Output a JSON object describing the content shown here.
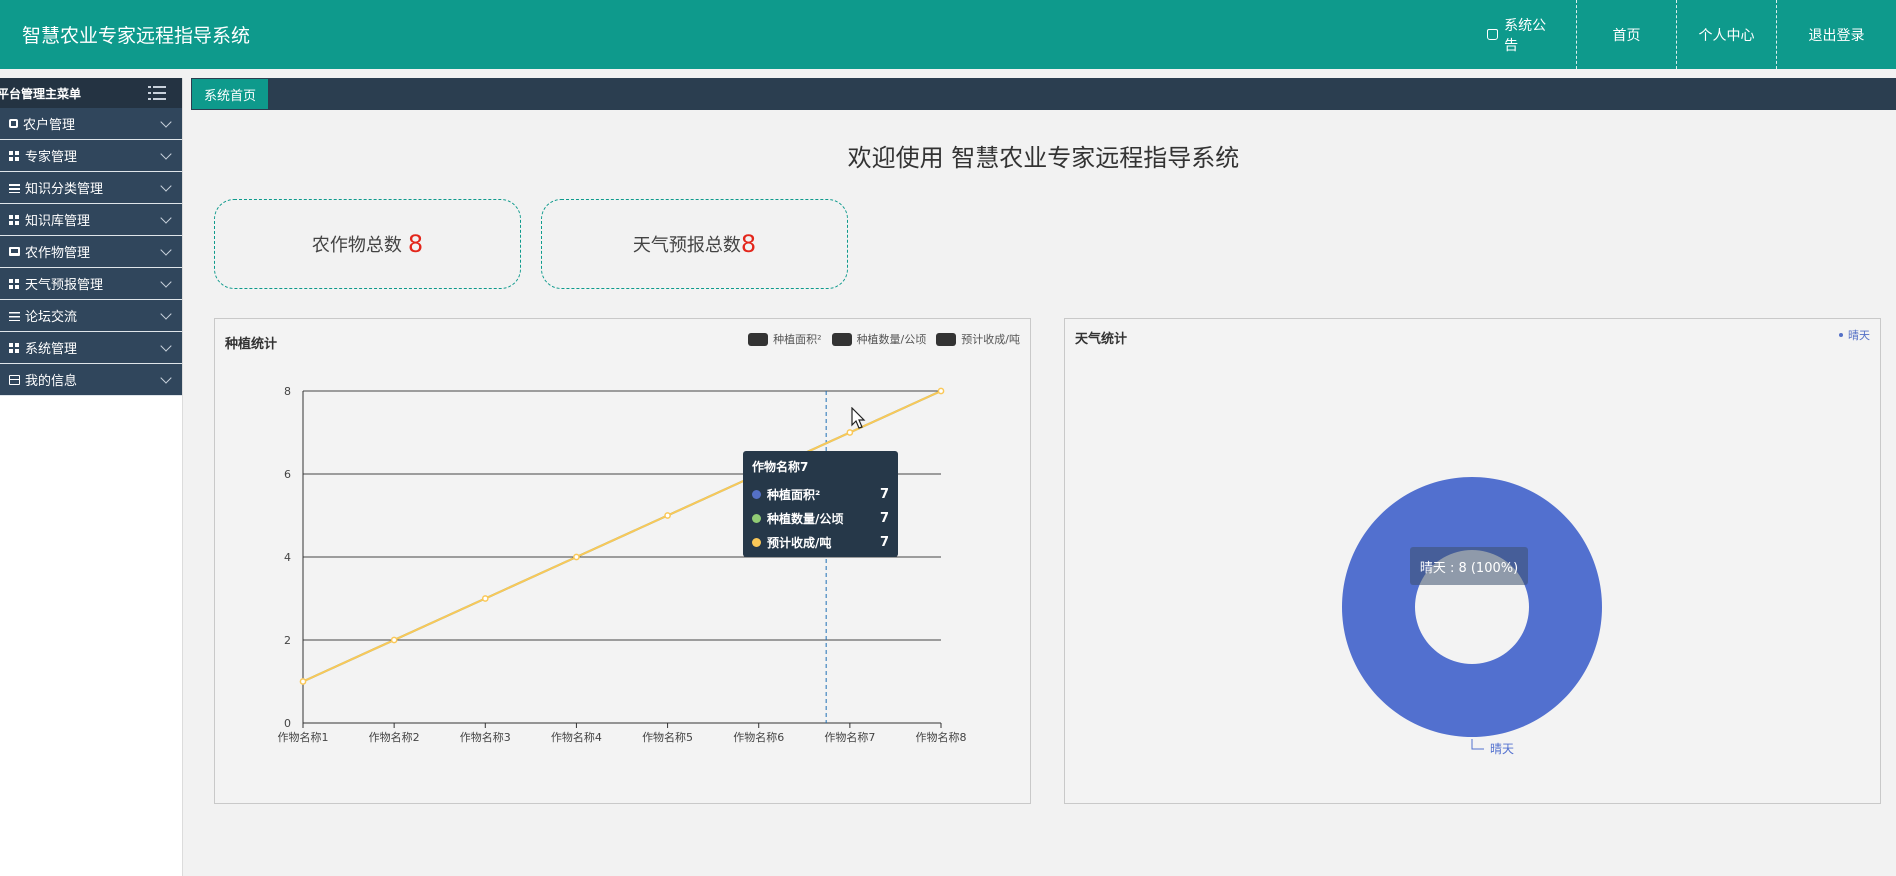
{
  "app": {
    "title": "智慧农业专家远程指导系统"
  },
  "topnav": {
    "notice": "系统公告",
    "home": "首页",
    "center": "个人中心",
    "logout": "退出登录"
  },
  "sidebar": {
    "title": "平台管理主菜单",
    "items": [
      {
        "label": "农户管理",
        "icon": "doc-icon"
      },
      {
        "label": "专家管理",
        "icon": "grid-icon"
      },
      {
        "label": "知识分类管理",
        "icon": "list-icon"
      },
      {
        "label": "知识库管理",
        "icon": "grid-icon"
      },
      {
        "label": "农作物管理",
        "icon": "monitor-icon"
      },
      {
        "label": "天气预报管理",
        "icon": "grid-icon"
      },
      {
        "label": "论坛交流",
        "icon": "slider-icon"
      },
      {
        "label": "系统管理",
        "icon": "grid-icon"
      },
      {
        "label": "我的信息",
        "icon": "card-icon"
      }
    ]
  },
  "tabs": {
    "home": "系统首页"
  },
  "welcome": "欢迎使用 智慧农业专家远程指导系统",
  "stats": {
    "crops_label": "农作物总数",
    "crops_value": "8",
    "weather_label": "天气预报总数",
    "weather_value": "8"
  },
  "colors": {
    "brand": "#0e9a8c",
    "nav_dark": "#2b3e50",
    "highlight_number": "#e3261b",
    "series_blue": "#5470c6",
    "series_green": "#91cc75",
    "series_yellow": "#fac858"
  },
  "planting_chart": {
    "title": "种植统计",
    "legend": [
      "种植面积²",
      "种植数量/公顷",
      "预计收成/吨"
    ],
    "tooltip": {
      "title": "作物名称7",
      "rows": [
        {
          "name": "种植面积²",
          "value": "7"
        },
        {
          "name": "种植数量/公顷",
          "value": "7"
        },
        {
          "name": "预计收成/吨",
          "value": "7"
        }
      ]
    }
  },
  "weather_chart": {
    "title": "天气统计",
    "legend": "晴天",
    "tooltip": "晴天 : 8 (100%)",
    "slice_label": "晴天"
  },
  "chart_data": [
    {
      "type": "line",
      "title": "种植统计",
      "categories": [
        "作物名称1",
        "作物名称2",
        "作物名称3",
        "作物名称4",
        "作物名称5",
        "作物名称6",
        "作物名称7",
        "作物名称8"
      ],
      "series": [
        {
          "name": "种植面积²",
          "values": [
            1,
            2,
            3,
            4,
            5,
            6,
            7,
            8
          ]
        },
        {
          "name": "种植数量/公顷",
          "values": [
            1,
            2,
            3,
            4,
            5,
            6,
            7,
            8
          ]
        },
        {
          "name": "预计收成/吨",
          "values": [
            1,
            2,
            3,
            4,
            5,
            6,
            7,
            8
          ]
        }
      ],
      "ylim": [
        0,
        8
      ],
      "yticks": [
        0,
        2,
        4,
        6,
        8
      ],
      "grid": true,
      "legend_position": "top-right"
    },
    {
      "type": "pie",
      "title": "天气统计",
      "slices": [
        {
          "label": "晴天",
          "value": 8,
          "percent": 100
        }
      ],
      "donut": true,
      "legend_position": "top-right"
    }
  ]
}
